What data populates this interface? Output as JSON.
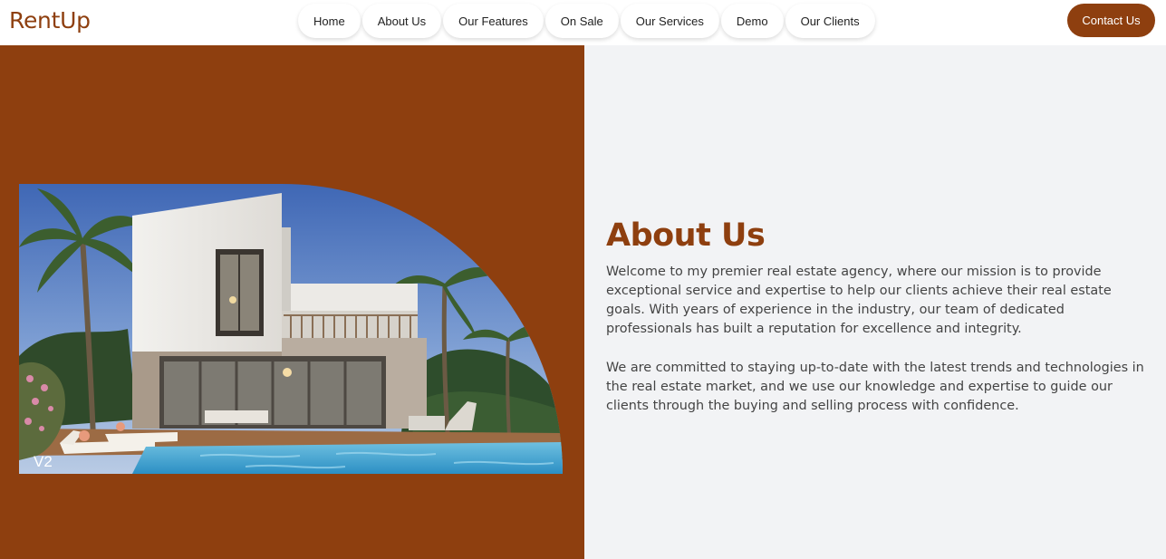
{
  "header": {
    "logo": "RentUp",
    "nav": [
      {
        "label": "Home"
      },
      {
        "label": "About Us"
      },
      {
        "label": "Our Features"
      },
      {
        "label": "On Sale"
      },
      {
        "label": "Our Services"
      },
      {
        "label": "Demo"
      },
      {
        "label": "Our Clients"
      }
    ],
    "contact_label": "Contact Us"
  },
  "hero": {
    "watermark": "V2",
    "image_subject": "modern white villa with pool and palm trees"
  },
  "about": {
    "title": "About Us",
    "paragraph_1": "Welcome to my premier real estate agency, where our mission is to provide exceptional service and expertise to help our clients achieve their real estate goals. With years of experience in the industry, our team of dedicated professionals has built a reputation for excellence and integrity.",
    "paragraph_2": "We are committed to staying up-to-date with the latest trends and technologies in the real estate market, and we use our knowledge and expertise to guide our clients through the buying and selling process with confidence."
  },
  "colors": {
    "brand": "#8e3f0f",
    "panel_bg": "#f2f3f5",
    "nav_bg": "#ffffff"
  }
}
